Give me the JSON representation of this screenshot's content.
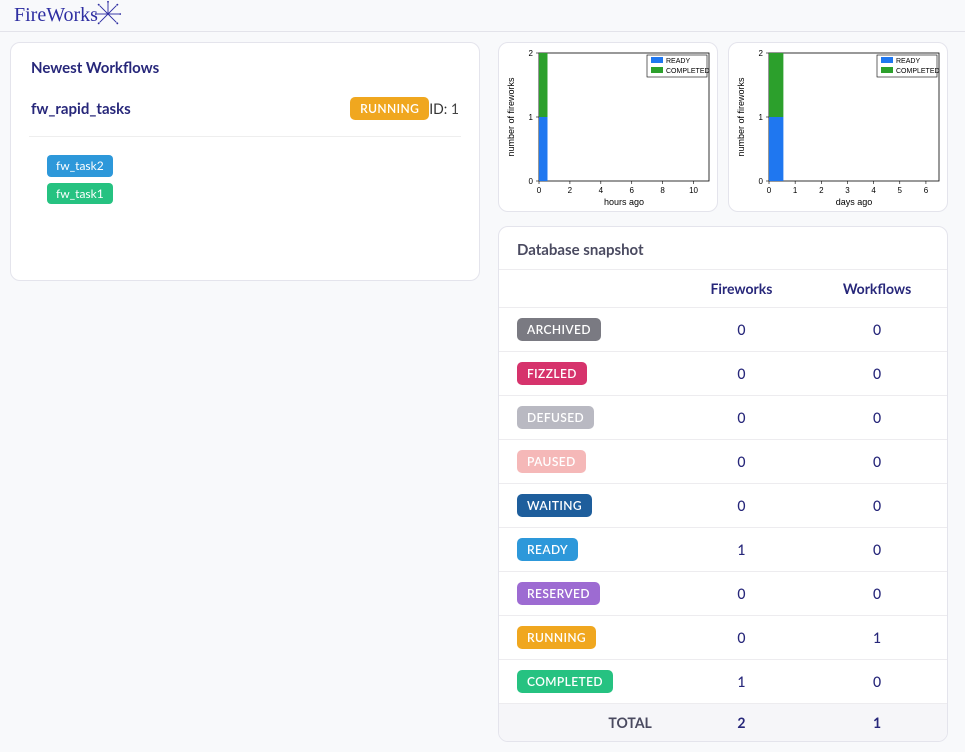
{
  "brand": "FireWorks",
  "leftPanelTitle": "Newest Workflows",
  "workflow": {
    "name": "fw_rapid_tasks",
    "status_label": "RUNNING",
    "id_label": "ID:",
    "id_value": "1",
    "tasks": [
      {
        "label": "fw_task2",
        "class": "ready"
      },
      {
        "label": "fw_task1",
        "class": "completed"
      }
    ]
  },
  "chart_data": [
    {
      "type": "bar-stacked",
      "xlabel": "hours ago",
      "ylabel": "number of fireworks",
      "xlim": [
        0,
        11
      ],
      "ylim": [
        0,
        2
      ],
      "xticks": [
        0,
        2,
        4,
        6,
        8,
        10
      ],
      "yticks": [
        0,
        1,
        2
      ],
      "legend": [
        "READY",
        "COMPLETED"
      ],
      "bars": [
        {
          "x": 0,
          "ready": 1,
          "completed": 1
        }
      ],
      "colors": {
        "READY": "#1f77f0",
        "COMPLETED": "#2ca02c"
      }
    },
    {
      "type": "bar-stacked",
      "xlabel": "days ago",
      "ylabel": "number of fireworks",
      "xlim": [
        0,
        6.5
      ],
      "ylim": [
        0,
        2
      ],
      "xticks": [
        0,
        1,
        2,
        3,
        4,
        5,
        6
      ],
      "yticks": [
        0,
        1,
        2
      ],
      "legend": [
        "READY",
        "COMPLETED"
      ],
      "bars": [
        {
          "x": 0,
          "ready": 1,
          "completed": 1
        }
      ],
      "colors": {
        "READY": "#1f77f0",
        "COMPLETED": "#2ca02c"
      }
    }
  ],
  "snapshot": {
    "title": "Database snapshot",
    "headers": {
      "first": "",
      "fireworks": "Fireworks",
      "workflows": "Workflows"
    },
    "rows": [
      {
        "label": "ARCHIVED",
        "class": "b-archived",
        "fireworks": 0,
        "workflows": 0
      },
      {
        "label": "FIZZLED",
        "class": "b-fizzled",
        "fireworks": 0,
        "workflows": 0
      },
      {
        "label": "DEFUSED",
        "class": "b-defused",
        "fireworks": 0,
        "workflows": 0
      },
      {
        "label": "PAUSED",
        "class": "b-paused",
        "fireworks": 0,
        "workflows": 0
      },
      {
        "label": "WAITING",
        "class": "b-waiting",
        "fireworks": 0,
        "workflows": 0
      },
      {
        "label": "READY",
        "class": "b-ready",
        "fireworks": 1,
        "workflows": 0
      },
      {
        "label": "RESERVED",
        "class": "b-reserved",
        "fireworks": 0,
        "workflows": 0
      },
      {
        "label": "RUNNING",
        "class": "b-running",
        "fireworks": 0,
        "workflows": 1
      },
      {
        "label": "COMPLETED",
        "class": "b-completed",
        "fireworks": 1,
        "workflows": 0
      }
    ],
    "total": {
      "label": "TOTAL",
      "fireworks": 2,
      "workflows": 1
    }
  }
}
